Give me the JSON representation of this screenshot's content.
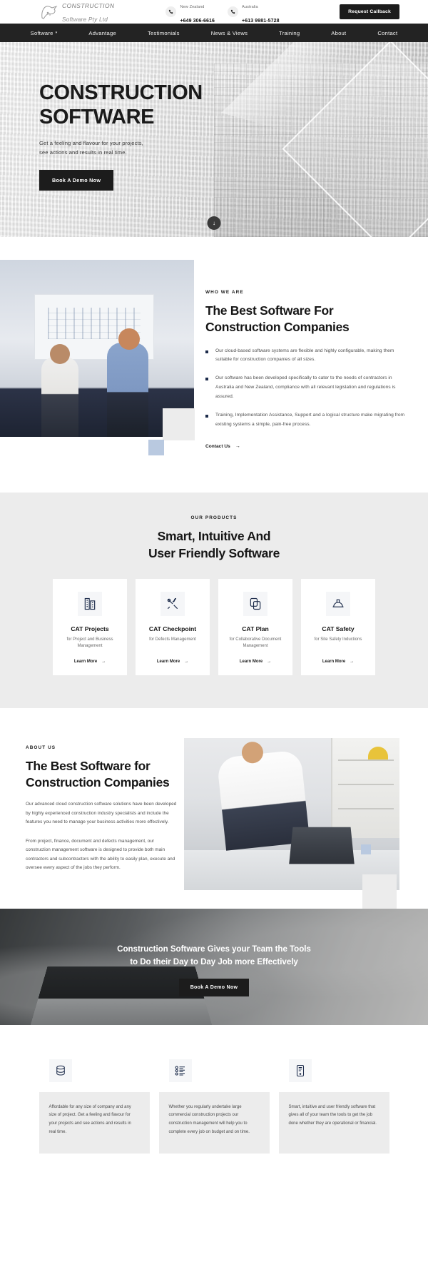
{
  "header": {
    "logo": {
      "line1": "CONSTRUCTION",
      "line2": "Software Pty Ltd",
      "icon": "koala-logo-icon"
    },
    "contacts": [
      {
        "country": "New Zealand",
        "number": "+649 306-6616"
      },
      {
        "country": "Australia",
        "number": "+613 9981-5728"
      }
    ],
    "callback_label": "Request Callback"
  },
  "nav": {
    "items": [
      {
        "label": "Software",
        "has_dropdown": true
      },
      {
        "label": "Advantage",
        "has_dropdown": false
      },
      {
        "label": "Testimonials",
        "has_dropdown": false
      },
      {
        "label": "News & Views",
        "has_dropdown": false
      },
      {
        "label": "Training",
        "has_dropdown": false
      },
      {
        "label": "About",
        "has_dropdown": false
      },
      {
        "label": "Contact",
        "has_dropdown": false
      }
    ]
  },
  "hero": {
    "title_line1": "CONSTRUCTION",
    "title_line2": "SOFTWARE",
    "sub_line1": "Get a feeling and flavour for your projects,",
    "sub_line2": "see actions and results in real time.",
    "button_label": "Book A Demo Now",
    "scroll_icon": "arrow-down-icon"
  },
  "who": {
    "eyebrow": "WHO WE ARE",
    "heading_line1": "The Best Software For",
    "heading_line2": "Construction Companies",
    "bullets": [
      "Our cloud-based software systems are flexible and highly configurable, making them suitable for construction companies of all sizes.",
      "Our software has been developed specifically to cater to the needs of contractors in Australia and New Zealand, compliance with all relevant legislation and regulations is assured.",
      "Training, Implementation Assistance, Support and a logical structure make migrating from existing systems a simple, pain-free process."
    ],
    "link_label": "Contact Us",
    "link_icon": "arrow-right-icon"
  },
  "products": {
    "eyebrow": "OUR PRODUCTS",
    "heading_line1": "Smart, Intuitive And",
    "heading_line2": "User Friendly Software",
    "cards": [
      {
        "name": "CAT Projects",
        "desc": "for Project and Business Management",
        "cta": "Learn More",
        "icon": "building-icon"
      },
      {
        "name": "CAT Checkpoint",
        "desc": "for Defects Management",
        "cta": "Learn More",
        "icon": "tools-icon"
      },
      {
        "name": "CAT Plan",
        "desc": "for Collaborative Document Management",
        "cta": "Learn More",
        "icon": "copy-documents-icon"
      },
      {
        "name": "CAT Safety",
        "desc": "for Site Safety Inductions",
        "cta": "Learn More",
        "icon": "hard-hat-icon"
      }
    ]
  },
  "about": {
    "eyebrow": "ABOUT US",
    "heading_line1": "The Best Software for",
    "heading_line2": "Construction Companies",
    "paragraph1": "Our advanced cloud construction software solutions have been developed by highly experienced construction industry specialists and include the features you need to manage your business activities more effectively.",
    "paragraph2": "From project, finance, document and defects management, our construction management software is designed to provide both main contractors and subcontractors with the ability to easily plan, execute and oversee every aspect of the jobs they perform."
  },
  "cta": {
    "heading_line1": "Construction Software Gives your Team the Tools",
    "heading_line2": "to Do their Day to Day Job more Effectively",
    "button_label": "Book A Demo Now"
  },
  "features": {
    "items": [
      {
        "icon": "database-stack-icon",
        "text": "Affordable for any size of company and any size of project. Get a feeling and flavour for your projects and see actions and results in real time."
      },
      {
        "icon": "list-items-icon",
        "text": "Whether you regularly undertake large commercial construction projects our construction management will help you to complete every job on budget and on time."
      },
      {
        "icon": "mobile-device-icon",
        "text": "Smart, intuitive and user friendly software that gives all of your team the tools to get the job done whether they are operational or financial."
      }
    ]
  },
  "colors": {
    "dark": "#232323",
    "accent": "#1c2b4a",
    "grey_bg": "#ececec",
    "blue_square": "#b9c9e0"
  }
}
